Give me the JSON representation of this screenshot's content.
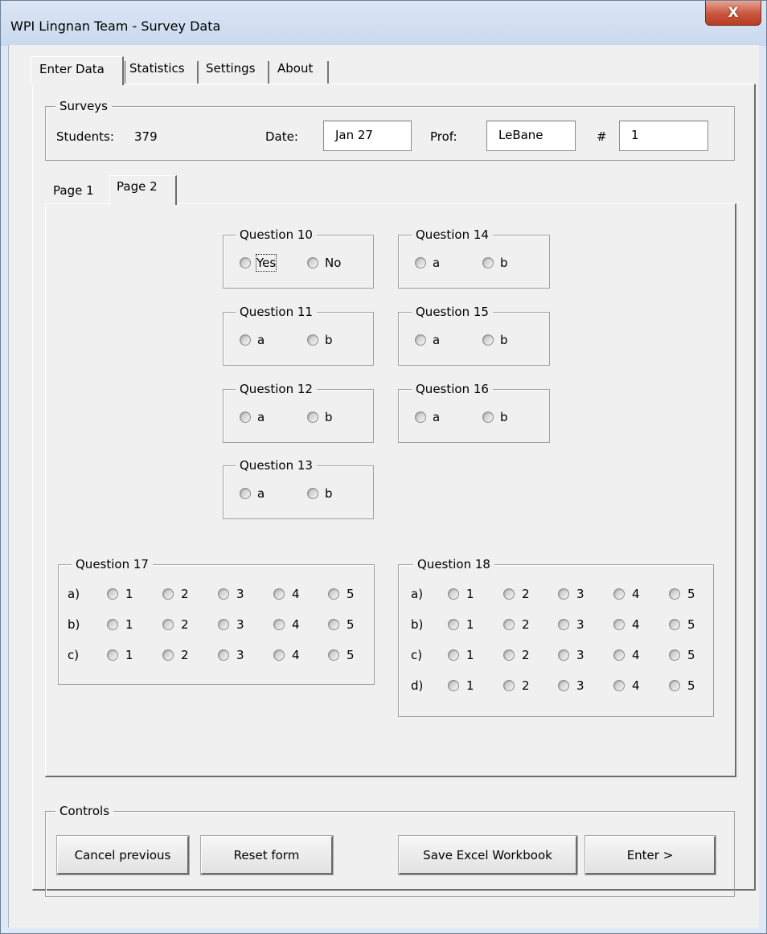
{
  "window": {
    "title": "WPI Lingnan Team - Survey Data",
    "close_label": "X"
  },
  "tabs": [
    "Enter Data",
    "Statistics",
    "Settings",
    "About"
  ],
  "surveys": {
    "legend": "Surveys",
    "students_label": "Students:",
    "students_value": "379",
    "date_label": "Date:",
    "date_value": "Jan 27",
    "prof_label": "Prof:",
    "prof_value": "LeBane",
    "number_label": "#",
    "number_value": "1"
  },
  "page_tabs": [
    "Page 1",
    "Page 2"
  ],
  "questions": {
    "q10": {
      "title": "Question 10",
      "options": [
        "Yes",
        "No"
      ]
    },
    "q11": {
      "title": "Question 11",
      "options": [
        "a",
        "b"
      ]
    },
    "q12": {
      "title": "Question 12",
      "options": [
        "a",
        "b"
      ]
    },
    "q13": {
      "title": "Question 13",
      "options": [
        "a",
        "b"
      ]
    },
    "q14": {
      "title": "Question 14",
      "options": [
        "a",
        "b"
      ]
    },
    "q15": {
      "title": "Question 15",
      "options": [
        "a",
        "b"
      ]
    },
    "q16": {
      "title": "Question 16",
      "options": [
        "a",
        "b"
      ]
    },
    "q17": {
      "title": "Question 17",
      "rows": [
        "a)",
        "b)",
        "c)"
      ],
      "scale": [
        "1",
        "2",
        "3",
        "4",
        "5"
      ]
    },
    "q18": {
      "title": "Question 18",
      "rows": [
        "a)",
        "b)",
        "c)",
        "d)"
      ],
      "scale": [
        "1",
        "2",
        "3",
        "4",
        "5"
      ]
    }
  },
  "controls": {
    "legend": "Controls",
    "cancel_previous": "Cancel previous",
    "reset_form": "Reset form",
    "save_workbook": "Save Excel Workbook",
    "enter": "Enter >"
  }
}
